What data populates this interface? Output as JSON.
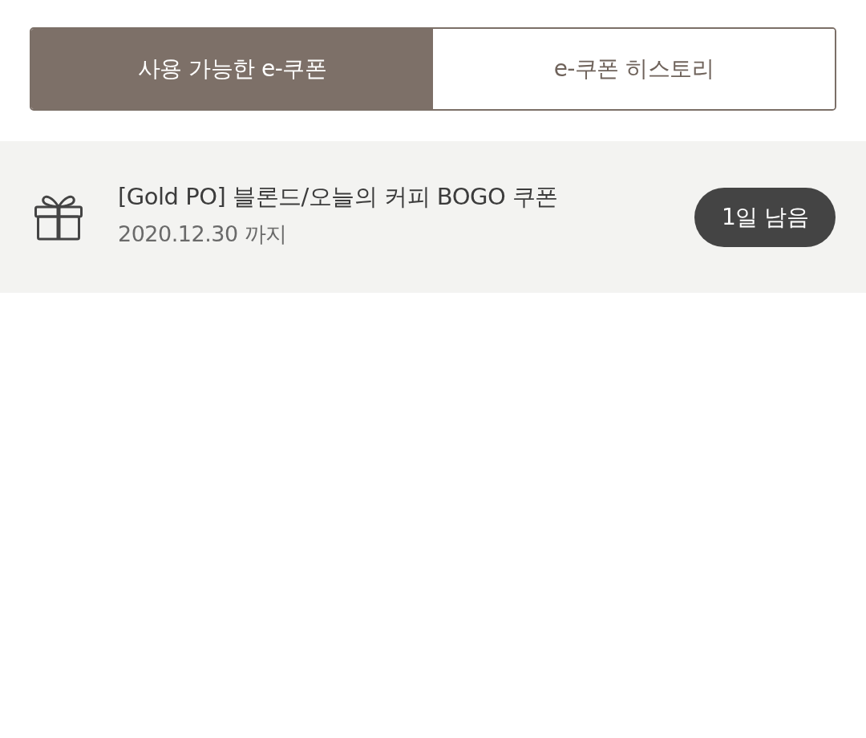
{
  "tabs": [
    {
      "label": "사용 가능한 e-쿠폰",
      "selected": true
    },
    {
      "label": "e-쿠폰 히스토리",
      "selected": false
    }
  ],
  "coupons": [
    {
      "title": "[Gold PO] 블론드/오늘의 커피 BOGO 쿠폰",
      "expiry": "2020.12.30 까지",
      "badge": "1일 남음"
    }
  ]
}
